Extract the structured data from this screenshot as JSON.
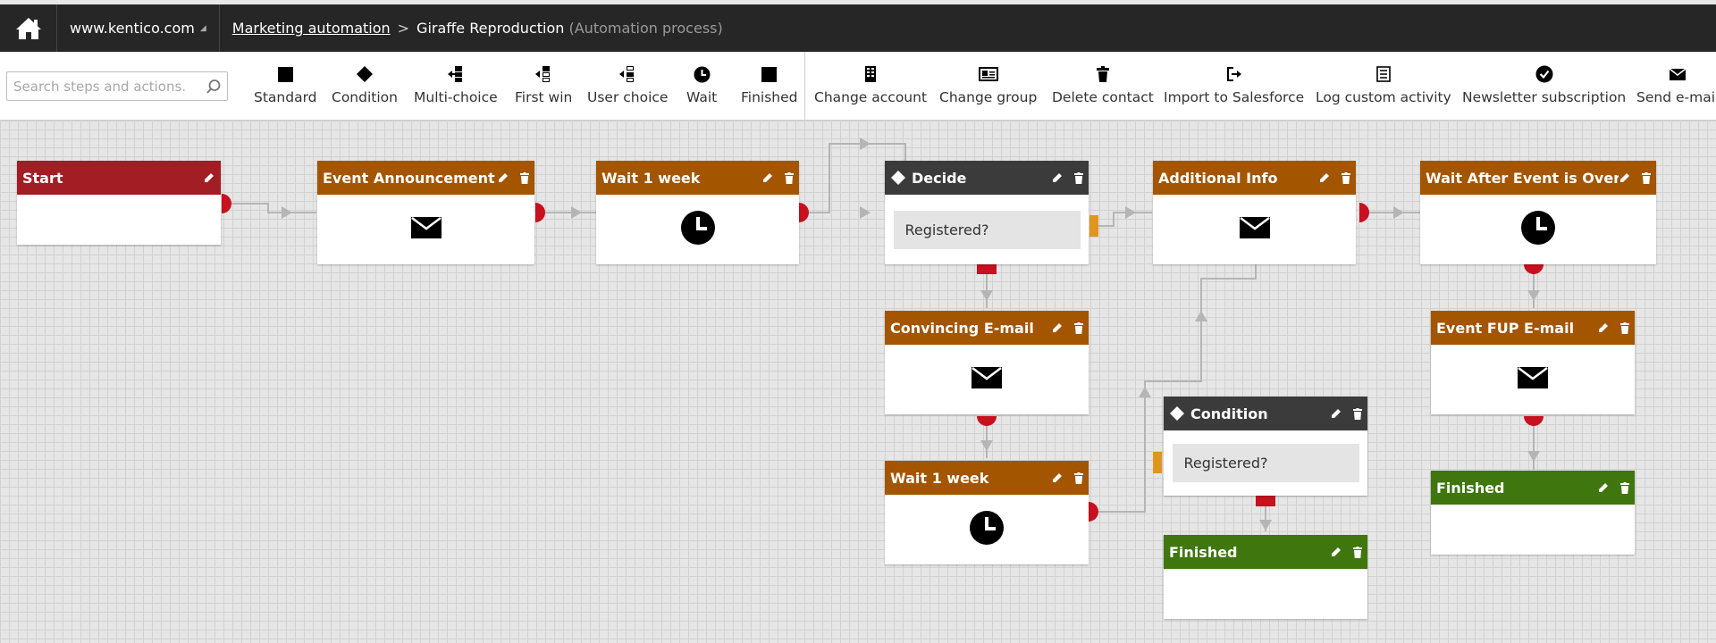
{
  "header": {
    "site": "www.kentico.com",
    "breadcrumb_link": "Marketing automation",
    "separator": ">",
    "process_name": "Giraffe Reproduction",
    "process_type": "(Automation process)"
  },
  "toolbar": {
    "search_placeholder": "Search steps and actions.",
    "steps": [
      {
        "label": "Standard",
        "icon": "square-icon"
      },
      {
        "label": "Condition",
        "icon": "diamond-icon"
      },
      {
        "label": "Multi-choice",
        "icon": "multi-choice-icon"
      },
      {
        "label": "First win",
        "icon": "first-win-icon"
      },
      {
        "label": "User choice",
        "icon": "user-choice-icon"
      },
      {
        "label": "Wait",
        "icon": "clock-icon"
      },
      {
        "label": "Finished",
        "icon": "square-icon"
      }
    ],
    "actions": [
      {
        "label": "Change account",
        "icon": "building-icon"
      },
      {
        "label": "Change group",
        "icon": "id-card-icon"
      },
      {
        "label": "Delete contact",
        "icon": "trash-icon"
      },
      {
        "label": "Import to Salesforce",
        "icon": "import-icon"
      },
      {
        "label": "Log custom activity",
        "icon": "list-icon"
      },
      {
        "label": "Newsletter subscription",
        "icon": "check-circle-icon"
      },
      {
        "label": "Send e-mail",
        "icon": "envelope-icon"
      }
    ]
  },
  "nodes": [
    {
      "title": "Start",
      "kind": "start",
      "color": "#a21d24"
    },
    {
      "title": "Event Announcement",
      "kind": "email",
      "color": "#a35500"
    },
    {
      "title": "Wait 1 week",
      "kind": "wait",
      "color": "#a35500"
    },
    {
      "title": "Decide",
      "kind": "condition",
      "condition": "Registered?",
      "color": "#3b3b3b"
    },
    {
      "title": "Additional Info",
      "kind": "email",
      "color": "#a35500"
    },
    {
      "title": "Wait After Event is Over",
      "kind": "wait",
      "color": "#a35500"
    },
    {
      "title": "Convincing E-mail",
      "kind": "email",
      "color": "#a35500"
    },
    {
      "title": "Event FUP E-mail",
      "kind": "email",
      "color": "#a35500"
    },
    {
      "title": "Wait 1 week",
      "kind": "wait",
      "color": "#a35500"
    },
    {
      "title": "Condition",
      "kind": "condition",
      "condition": "Registered?",
      "color": "#3b3b3b"
    },
    {
      "title": "Finished",
      "kind": "finished",
      "color": "#3f760d"
    },
    {
      "title": "Finished",
      "kind": "finished",
      "color": "#3f760d"
    }
  ]
}
